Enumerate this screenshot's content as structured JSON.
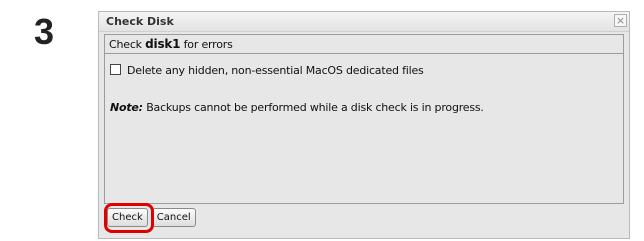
{
  "step": {
    "number": "3"
  },
  "dialog": {
    "title": "Check Disk",
    "close_icon": "close-icon",
    "check_prefix": "Check",
    "disk_name": "disk1",
    "check_suffix": "for errors",
    "checkbox_label": "Delete any hidden, non-essential MacOS dedicated files",
    "checkbox_checked": false,
    "note_label": "Note:",
    "note_text": "Backups cannot be performed while a disk check is in progress.",
    "buttons": {
      "check": "Check",
      "cancel": "Cancel"
    }
  },
  "colors": {
    "highlight": "#e10000"
  }
}
